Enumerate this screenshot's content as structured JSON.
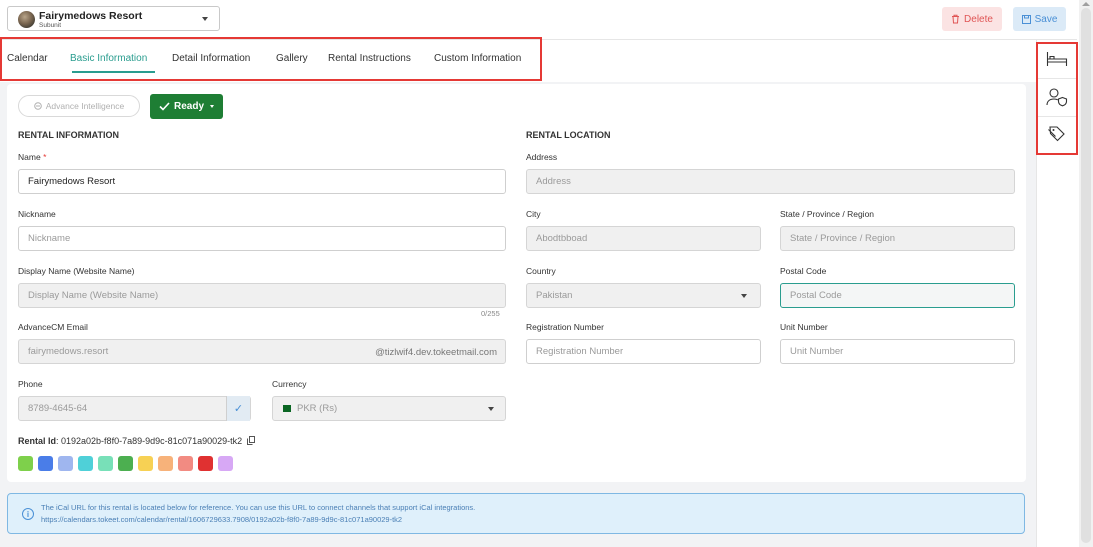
{
  "header": {
    "subunit_name": "Fairymedows Resort",
    "subunit_tag": "Subunit",
    "delete_label": "Delete",
    "save_label": "Save"
  },
  "tabs": [
    {
      "label": "Calendar"
    },
    {
      "label": "Basic Information",
      "active": true
    },
    {
      "label": "Detail Information"
    },
    {
      "label": "Gallery"
    },
    {
      "label": "Rental Instructions"
    },
    {
      "label": "Custom Information"
    }
  ],
  "toolbar": {
    "ai_label": "Advance Intelligence",
    "status_label": "Ready"
  },
  "rental_info": {
    "section_title": "RENTAL INFORMATION",
    "name_label": "Name",
    "name_required": "*",
    "name_value": "Fairymedows Resort",
    "nickname_label": "Nickname",
    "nickname_placeholder": "Nickname",
    "display_label": "Display Name (Website Name)",
    "display_placeholder": "Display Name (Website Name)",
    "display_counter": "0/255",
    "email_label": "AdvanceCM Email",
    "email_value": "fairymedows.resort",
    "email_suffix": "@tizlwif4.dev.tokeetmail.com",
    "phone_label": "Phone",
    "phone_value": "8789-4645-64",
    "currency_label": "Currency",
    "currency_value": "PKR (Rs)",
    "rental_id_label": "Rental Id",
    "rental_id_value": ": 0192a02b-f8f0-7a89-9d9c-81c071a90029-tk2"
  },
  "rental_location": {
    "section_title": "RENTAL LOCATION",
    "address_label": "Address",
    "address_placeholder": "Address",
    "city_label": "City",
    "city_value": "Abodtbboad",
    "state_label": "State / Province / Region",
    "state_placeholder": "State / Province / Region",
    "country_label": "Country",
    "country_value": "Pakistan",
    "postal_label": "Postal Code",
    "postal_placeholder": "Postal Code",
    "reg_label": "Registration Number",
    "reg_placeholder": "Registration Number",
    "unit_label": "Unit Number",
    "unit_placeholder": "Unit Number"
  },
  "colors": [
    "#7ed04b",
    "#4a7de8",
    "#9fb6ef",
    "#4fd0d8",
    "#78e0b8",
    "#4caf50",
    "#f7d154",
    "#f7b27a",
    "#f28b82",
    "#e03131",
    "#d7a8f5"
  ],
  "accent": "#2a9d8f",
  "info": {
    "line1": "The iCal URL for this rental is located below for reference. You can use this URL to connect channels that support iCal integrations.",
    "line2": "https://calendars.tokeet.com/calendar/rental/1606729633.7908/0192a02b-f8f0-7a89-9d9c-81c071a90029-tk2"
  },
  "rail_icons": [
    "bed-icon",
    "user-shield-icon",
    "tag-icon"
  ]
}
